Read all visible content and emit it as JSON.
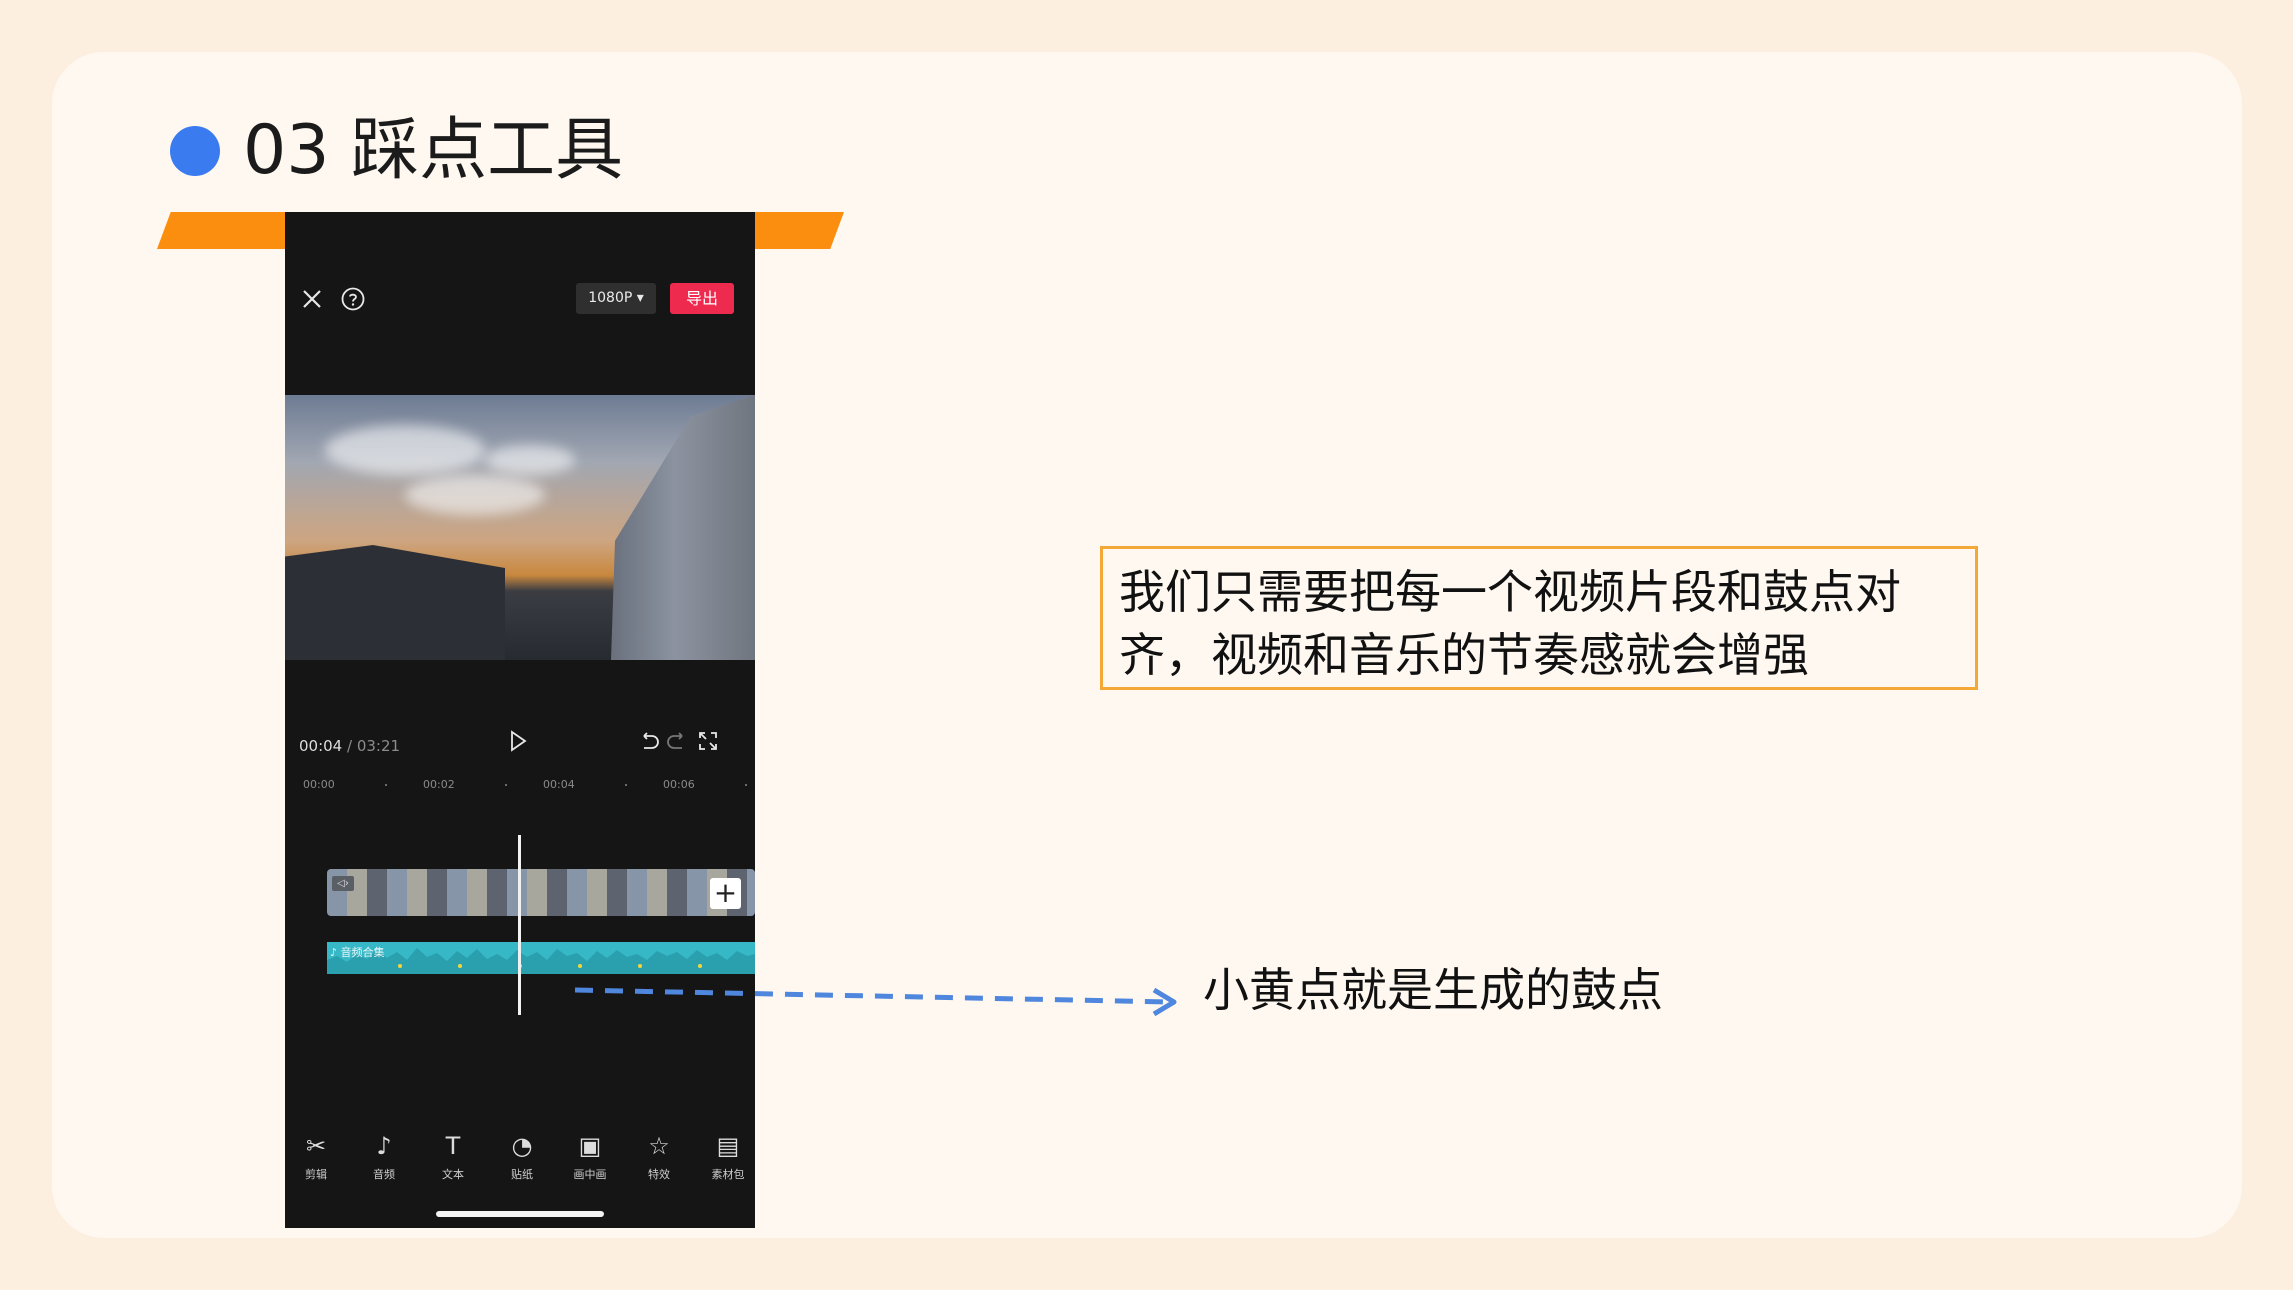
{
  "slide": {
    "title": "03 踩点工具",
    "colors": {
      "accent_blue": "#3a7cf0",
      "accent_orange": "#fb8d0f",
      "box_border": "#f3a838",
      "arrow": "#4f86de"
    },
    "callout_box_text": "我们只需要把每一个视频片段和鼓点对齐，视频和音乐的节奏感就会增强",
    "arrow_annotation": "小黄点就是生成的鼓点"
  },
  "app": {
    "top_bar": {
      "close_icon": "close-icon",
      "help_icon": "help-icon",
      "resolution_label": "1080P ▾",
      "export_label": "导出"
    },
    "playback": {
      "current_time": "00:04",
      "separator": " / ",
      "total_time": "03:21",
      "play_icon": "play-icon",
      "undo_icon": "undo-icon",
      "redo_icon": "redo-icon",
      "fullscreen_icon": "fullscreen-icon"
    },
    "ruler": [
      "00:00",
      "00:02",
      "00:04",
      "00:06"
    ],
    "timeline": {
      "video_track_icon": "speaker-icon",
      "add_clip_label": "+",
      "audio_track_label": "音频合集"
    },
    "toolbar": [
      {
        "icon": "scissors-icon",
        "glyph": "✂",
        "label": "剪辑"
      },
      {
        "icon": "music-icon",
        "glyph": "♪",
        "label": "音频"
      },
      {
        "icon": "text-icon",
        "glyph": "T",
        "label": "文本"
      },
      {
        "icon": "sticker-icon",
        "glyph": "◔",
        "label": "贴纸"
      },
      {
        "icon": "pip-icon",
        "glyph": "▣",
        "label": "画中画"
      },
      {
        "icon": "effects-icon",
        "glyph": "☆",
        "label": "特效"
      },
      {
        "icon": "material-icon",
        "glyph": "▤",
        "label": "素材包"
      }
    ]
  }
}
